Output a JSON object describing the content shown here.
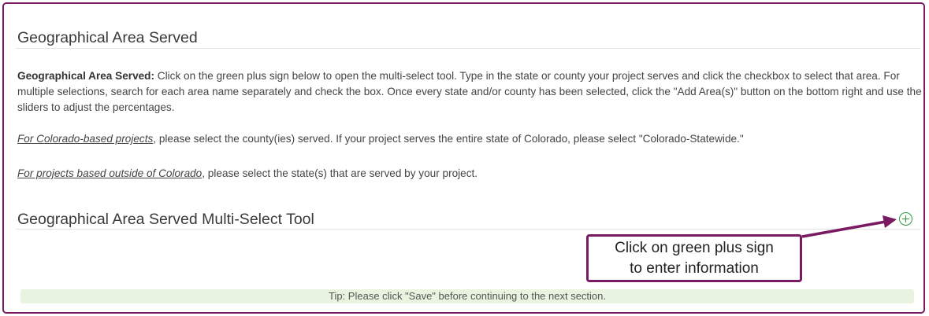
{
  "section": {
    "title": "Geographical Area Served",
    "intro_bold": "Geographical Area Served:",
    "intro_text": " Click on the green plus sign below to open the multi-select tool. Type in the state or county your project serves and click the checkbox to select that area. For multiple selections, search for each area name separately and check the box. Once every state and/or county has been selected, click the \"Add Area(s)\" button on the bottom right and use the sliders to adjust the percentages.",
    "colorado_link": "For Colorado-based projects",
    "colorado_text": ", please select the county(ies) served. If your project serves the entire state of Colorado, please select \"Colorado-Statewide.\"",
    "outside_link": "For projects based outside of Colorado",
    "outside_text": ", please select the state(s) that are served by your project."
  },
  "tool": {
    "title": "Geographical Area Served Multi-Select Tool",
    "add_icon": "plus-circle-icon"
  },
  "callout": {
    "line1": "Click on green plus sign",
    "line2": "to enter information"
  },
  "tip": "Tip: Please click \"Save\" before continuing to the next section.",
  "colors": {
    "accent": "#7a1a63",
    "plus": "#2e9a3c",
    "tip_bg": "#e8f3e0"
  }
}
